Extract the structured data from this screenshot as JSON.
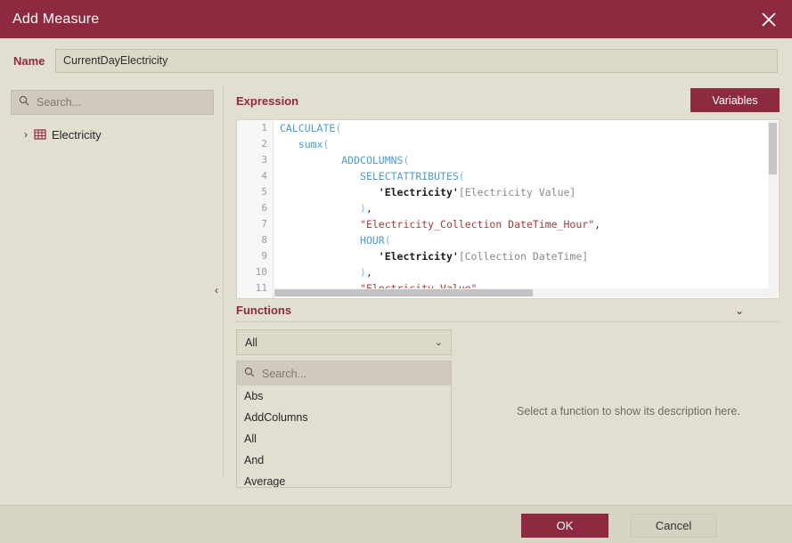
{
  "window": {
    "title": "Add Measure",
    "close_icon": "close-icon"
  },
  "name_field": {
    "label": "Name",
    "value": "CurrentDayElectricity",
    "placeholder": ""
  },
  "left_panel": {
    "search": {
      "placeholder": "Search...",
      "value": "",
      "icon": "search-icon"
    },
    "tree": [
      {
        "label": "Electricity",
        "icon": "table-icon",
        "chevron": "chevron-right-icon",
        "expanded": false
      }
    ],
    "collapse_handle": "‹"
  },
  "expression": {
    "title": "Expression",
    "variables_button": "Variables",
    "line_numbers": [
      "1",
      "2",
      "3",
      "4",
      "5",
      "6",
      "7",
      "8",
      "9",
      "10",
      "11"
    ],
    "lines": [
      [
        {
          "t": "fn",
          "s": "CALCULATE"
        },
        {
          "t": "par",
          "s": "("
        }
      ],
      [
        {
          "t": "pln",
          "s": "   "
        },
        {
          "t": "fn",
          "s": "sumx"
        },
        {
          "t": "par",
          "s": "("
        }
      ],
      [
        {
          "t": "pln",
          "s": "          "
        },
        {
          "t": "fn",
          "s": "ADDCOLUMNS"
        },
        {
          "t": "par",
          "s": "("
        }
      ],
      [
        {
          "t": "pln",
          "s": "             "
        },
        {
          "t": "fn",
          "s": "SELECTATTRIBUTES"
        },
        {
          "t": "par",
          "s": "("
        }
      ],
      [
        {
          "t": "pln",
          "s": "                "
        },
        {
          "t": "tbl",
          "s": "'Electricity'"
        },
        {
          "t": "col",
          "s": "[Electricity Value]"
        }
      ],
      [
        {
          "t": "pln",
          "s": "             "
        },
        {
          "t": "par",
          "s": ")"
        },
        {
          "t": "pln",
          "s": ","
        }
      ],
      [
        {
          "t": "pln",
          "s": "             "
        },
        {
          "t": "str",
          "s": "\"Electricity_Collection DateTime_Hour\""
        },
        {
          "t": "pln",
          "s": ","
        }
      ],
      [
        {
          "t": "pln",
          "s": "             "
        },
        {
          "t": "fn",
          "s": "HOUR"
        },
        {
          "t": "par",
          "s": "("
        }
      ],
      [
        {
          "t": "pln",
          "s": "                "
        },
        {
          "t": "tbl",
          "s": "'Electricity'"
        },
        {
          "t": "col",
          "s": "[Collection DateTime]"
        }
      ],
      [
        {
          "t": "pln",
          "s": "             "
        },
        {
          "t": "par",
          "s": ")"
        },
        {
          "t": "pln",
          "s": ","
        }
      ],
      [
        {
          "t": "pln",
          "s": "             "
        },
        {
          "t": "str",
          "s": "\"Electricity Value\""
        }
      ]
    ]
  },
  "functions": {
    "title": "Functions",
    "collapse_icon": "chevron-down-icon",
    "category_selected": "All",
    "search": {
      "placeholder": "Search...",
      "value": "",
      "icon": "search-icon"
    },
    "items": [
      "Abs",
      "AddColumns",
      "All",
      "And",
      "Average"
    ],
    "description_placeholder": "Select a function to show its description here."
  },
  "footer": {
    "ok_label": "OK",
    "cancel_label": "Cancel"
  },
  "colors": {
    "accent": "#8e2a40",
    "background": "#e3dfd0",
    "field": "#ddd9c9",
    "search_field": "#d0cabd",
    "footer": "#d9d5c5",
    "code_background": "#ffffff",
    "code_function": "#4a9cd6",
    "code_string": "#a33a3a",
    "code_column": "#8a8a8a",
    "code_table": "#1c1c1c"
  }
}
